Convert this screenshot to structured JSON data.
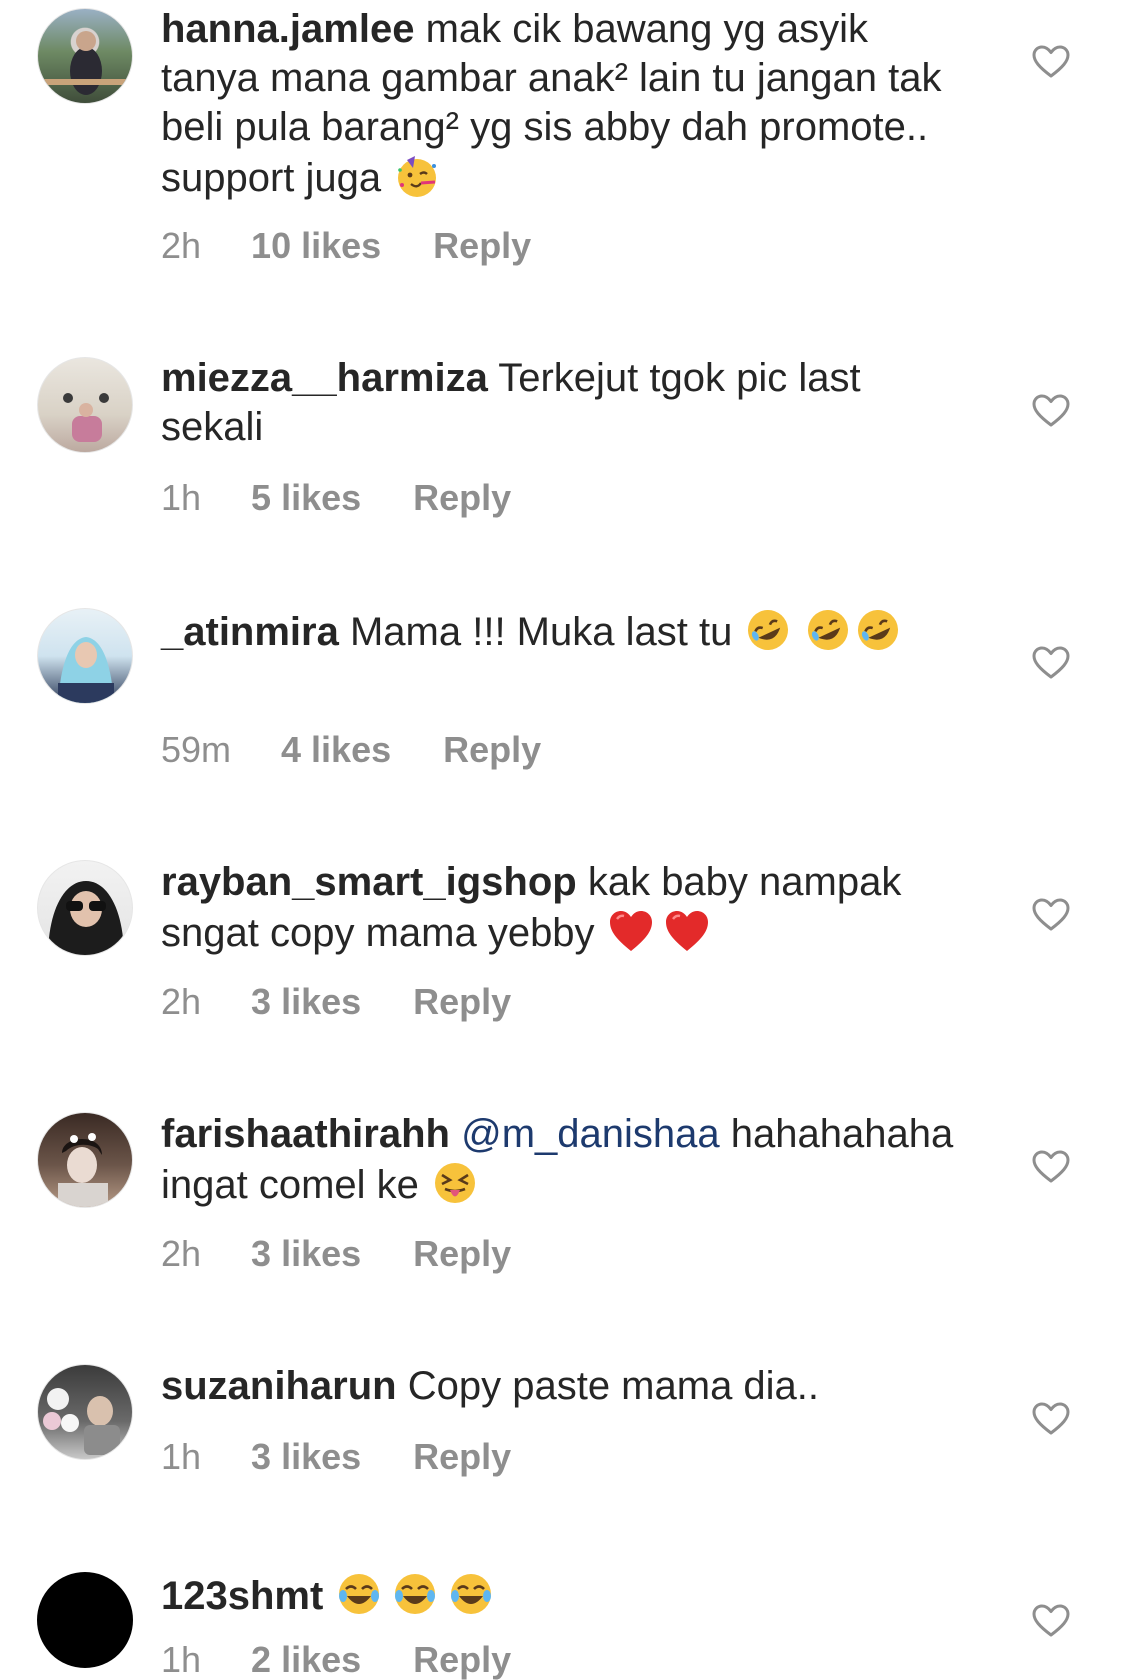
{
  "comments": [
    {
      "username": "hanna.jamlee",
      "text": "mak cik bawang yg asyik tanya mana gambar anak² lain tu jangan tak beli pula barang² yg sis abby dah promote.. support juga",
      "emojis": [
        "party-face-emoji"
      ],
      "time": "2h",
      "likes": "10 likes",
      "reply": "Reply"
    },
    {
      "username": "miezza__harmiza",
      "text": "Terkejut tgok pic last sekali",
      "emojis": [],
      "time": "1h",
      "likes": "5 likes",
      "reply": "Reply"
    },
    {
      "username": "_atinmira",
      "text": "Mama !!! Muka last tu",
      "emojis": [
        "rofl-emoji",
        "rofl-emoji",
        "rofl-emoji"
      ],
      "time": "59m",
      "likes": "4 likes",
      "reply": "Reply"
    },
    {
      "username": "rayban_smart_igshop",
      "text": "kak baby nampak sngat copy mama yebby",
      "emojis": [
        "red-heart-emoji",
        "red-heart-emoji"
      ],
      "time": "2h",
      "likes": "3 likes",
      "reply": "Reply"
    },
    {
      "username": "farishaathirahh",
      "mention": "@m_danishaa",
      "text": "hahahahaha ingat comel ke",
      "emojis": [
        "squinting-tongue-emoji"
      ],
      "time": "2h",
      "likes": "3 likes",
      "reply": "Reply"
    },
    {
      "username": "suzaniharun",
      "text": "Copy paste mama dia..",
      "emojis": [],
      "time": "1h",
      "likes": "3 likes",
      "reply": "Reply"
    },
    {
      "username": "123shmt",
      "text": "",
      "emojis": [
        "tears-of-joy-emoji",
        "tears-of-joy-emoji",
        "tears-of-joy-emoji"
      ],
      "time": "1h",
      "likes": "2 likes",
      "reply": "Reply"
    }
  ],
  "icons": {
    "like": "heart-outline-icon"
  },
  "colors": {
    "text": "#262626",
    "meta": "#8e8e8e",
    "mention": "#1d3a6e",
    "heart_outline": "#8e8e8e"
  }
}
